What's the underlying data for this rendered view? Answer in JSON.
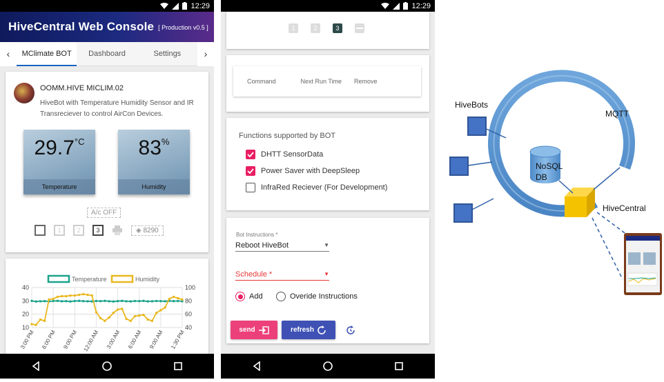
{
  "statusbar": {
    "time": "12:29"
  },
  "phone1": {
    "app_title": "HiveCentral Web Console",
    "app_badge": "[ Production v0.5 ]",
    "tabs": [
      {
        "label": "MClimate BOT"
      },
      {
        "label": "Dashboard"
      },
      {
        "label": "Settings"
      }
    ],
    "device": {
      "name": "OOMM.HIVE MICLIM.02",
      "description": "HiveBot with Temperature Humidity Sensor and IR Transreciever to control AirCon Devices."
    },
    "temperature": {
      "value": "29.7",
      "unit": "°C",
      "label": "Temperature"
    },
    "humidity": {
      "value": "83",
      "unit": "%",
      "label": "Humidity"
    },
    "ac_status": "A/c OFF",
    "code_value": "8290",
    "icon_numbers": [
      "1",
      "2",
      "3"
    ]
  },
  "chart_data": {
    "type": "line",
    "legend": [
      "Temperature",
      "Humidity"
    ],
    "x_ticks": [
      "3:00 PM",
      "6:00 PM",
      "9:00 PM",
      "12:00 AM",
      "3:00 AM",
      "6:00 AM",
      "9:00 AM",
      "1:30 PM"
    ],
    "y_left_ticks": [
      "10",
      "20",
      "30",
      "40"
    ],
    "y_right_ticks": [
      "40",
      "60",
      "80",
      "100"
    ],
    "ylim_left": [
      10,
      40
    ],
    "ylim_right": [
      40,
      100
    ],
    "colors": {
      "temperature": "#1aa38a",
      "humidity": "#e8b81e"
    },
    "series": [
      {
        "name": "Temperature",
        "axis": "left",
        "values": [
          30,
          29.5,
          29.7,
          29.8,
          29.6,
          29.9,
          30,
          29.7,
          29.8,
          29.5,
          29.9,
          30,
          29.8,
          29.7,
          29.6,
          29.9,
          29.8,
          30,
          29.7,
          29.5,
          29.8,
          30,
          29.7,
          29.6,
          29.9,
          29.8,
          30,
          29.6,
          29.7,
          29.9,
          29.8,
          29.7,
          30,
          29.8,
          29.9,
          29.7
        ]
      },
      {
        "name": "Humidity",
        "axis": "right",
        "values": [
          45,
          44,
          52,
          50,
          82,
          83,
          86,
          87,
          87,
          88,
          88,
          89,
          90,
          89,
          88,
          63,
          54,
          50,
          55,
          62,
          67,
          68,
          53,
          50,
          57,
          58,
          59,
          52,
          50,
          62,
          66,
          70,
          83,
          86,
          84,
          82
        ]
      }
    ]
  },
  "phone2": {
    "pager": [
      "1",
      "2",
      "3"
    ],
    "schedule_columns": [
      "Command",
      "Next Run Time",
      "Remove"
    ],
    "functions_title": "Functions supported by BOT",
    "functions": [
      {
        "label": "DHTT SensorData",
        "checked": true
      },
      {
        "label": "Power Saver with DeepSleep",
        "checked": true
      },
      {
        "label": "InfraRed Reciever (For Development)",
        "checked": false
      }
    ],
    "bot_instructions_label": "Bot Instructions *",
    "bot_instructions_value": "Reboot HiveBot",
    "schedule_placeholder": "Schedule *",
    "radio_add": "Add",
    "radio_override": "Overide Instructions",
    "send_label": "send",
    "refresh_label": "refresh"
  },
  "diagram": {
    "labels": {
      "hivebots": "HiveBots",
      "mqtt": "MQTT",
      "nosql": "NoSQL",
      "db": "DB",
      "hivecentral": "HiveCentral"
    },
    "colors": {
      "ring": "#5b9bd5",
      "bot": "#4472c4",
      "cube": "#f5c200"
    }
  }
}
